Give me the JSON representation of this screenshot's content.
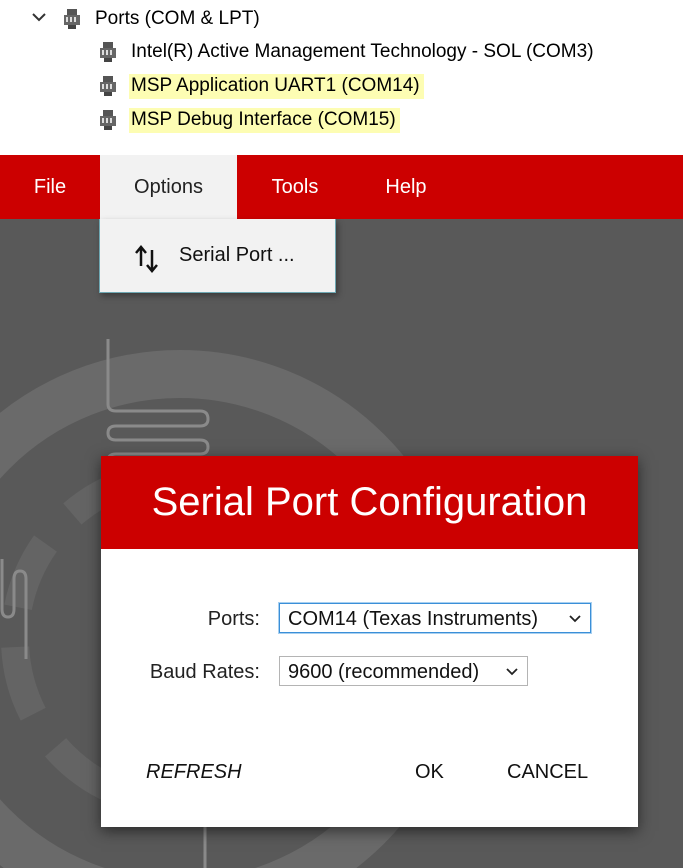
{
  "device_tree": {
    "category": "Ports (COM & LPT)",
    "items": [
      {
        "label": "Intel(R) Active Management Technology - SOL (COM3)",
        "highlighted": false
      },
      {
        "label": "MSP Application UART1 (COM14)",
        "highlighted": true
      },
      {
        "label": "MSP Debug Interface (COM15)",
        "highlighted": true
      }
    ],
    "highlight_color": "#fdfdb3"
  },
  "menubar": {
    "items": [
      "File",
      "Options",
      "Tools",
      "Help"
    ],
    "active": "Options",
    "color": "#cc0000"
  },
  "options_menu": {
    "items": [
      {
        "label": "Serial Port ...",
        "icon": "up-down-arrows-icon"
      }
    ]
  },
  "dialog": {
    "title": "Serial Port Configuration",
    "header_color": "#cc0000",
    "ports": {
      "label": "Ports:",
      "value": "COM14 (Texas Instruments)"
    },
    "baud": {
      "label": "Baud Rates:",
      "value": "9600 (recommended)"
    },
    "buttons": {
      "refresh": "REFRESH",
      "ok": "OK",
      "cancel": "CANCEL"
    }
  }
}
